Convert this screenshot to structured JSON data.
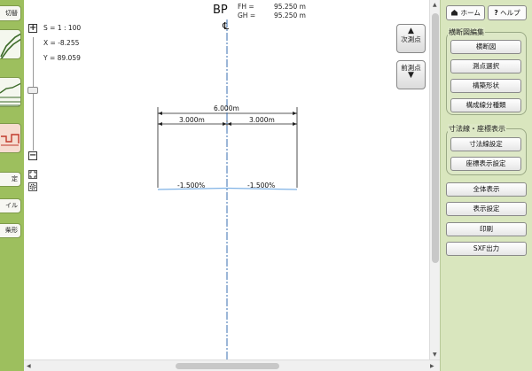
{
  "left_sidebar": {
    "buttons": [
      {
        "label": "切替"
      },
      {
        "label": "定"
      },
      {
        "label": "イル"
      },
      {
        "label": "柴形"
      }
    ],
    "views": [
      {
        "icon": "cross-section-view-icon"
      },
      {
        "icon": "profile-view-icon"
      },
      {
        "icon": "plan-view-icon",
        "active": true
      }
    ]
  },
  "zoom": {
    "plus": "+",
    "minus": "−",
    "fit_icon": "fit-view-icon",
    "settings_icon": "gear-icon",
    "level": 0.55
  },
  "coords": {
    "scale": "S = 1 : 100",
    "x": "X = -8.255",
    "y": "Y = 89.059"
  },
  "header": {
    "station": "BP",
    "fh_label": "FH =",
    "fh_value": "95.250 m",
    "gh_label": "GH =",
    "gh_value": "95.250 m",
    "centerline_mark": "℄"
  },
  "nav": {
    "next": {
      "arrow": "▲",
      "label": "次測点"
    },
    "prev": {
      "arrow": "▼",
      "label": "前測点"
    }
  },
  "drawing": {
    "total_width": "6.000m",
    "left_width": "3.000m",
    "right_width": "3.000m",
    "left_slope": "-1.500%",
    "right_slope": "-1.500%",
    "centerline_color": "#3a6fb0",
    "road_color": "#7fb2e5"
  },
  "right_panel": {
    "home": "ホーム",
    "help": "ヘルプ",
    "home_icon": "home-icon",
    "help_icon": "help-icon",
    "group1": {
      "title": "横断図編集",
      "buttons": [
        "横断図",
        "測点選択",
        "構築形状",
        "構成線分種類"
      ]
    },
    "group2": {
      "title": "寸法線・座標表示",
      "buttons": [
        "寸法線設定",
        "座標表示設定"
      ]
    },
    "buttons": [
      "全体表示",
      "表示設定",
      "印刷",
      "SXF出力"
    ]
  },
  "scroll": {
    "vertical_position": 0.05,
    "horizontal_position": 0.37
  }
}
